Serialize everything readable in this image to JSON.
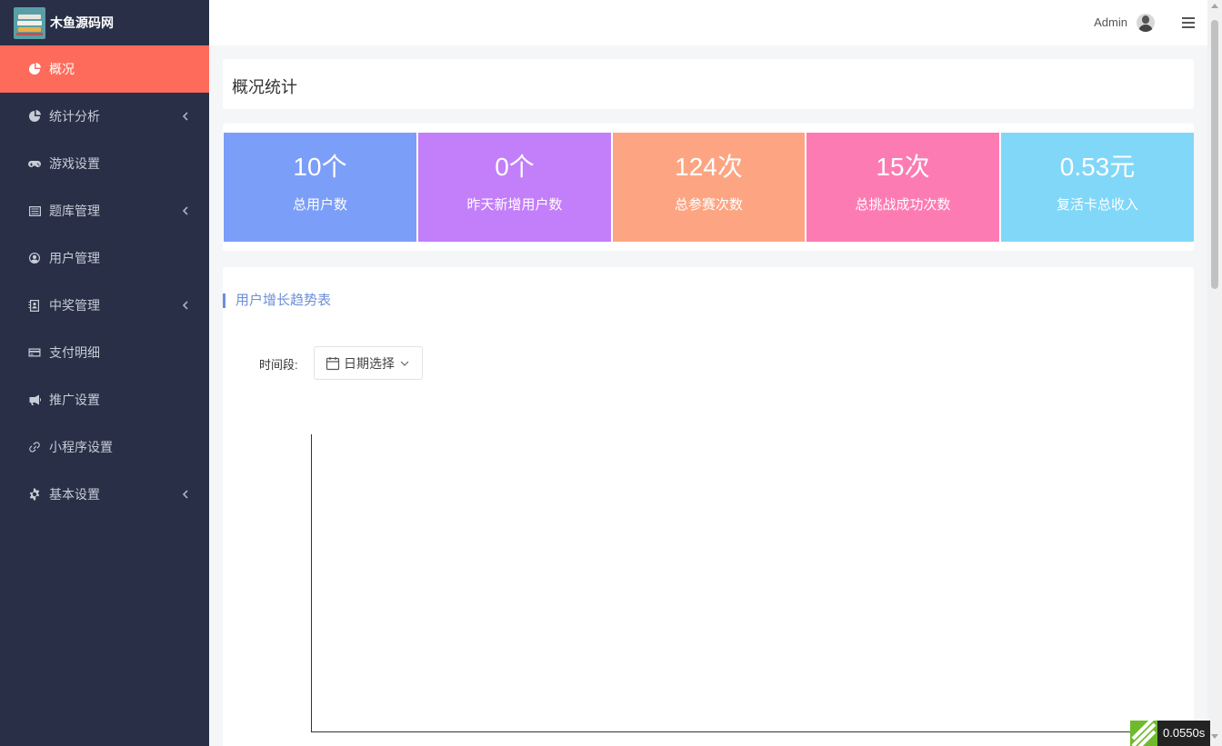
{
  "brand": {
    "name": "木鱼源码网"
  },
  "sidebar": {
    "items": [
      {
        "label": "概况",
        "icon": "pie-chart-icon",
        "active": true,
        "has_submenu": false
      },
      {
        "label": "统计分析",
        "icon": "pie-chart-icon",
        "active": false,
        "has_submenu": true
      },
      {
        "label": "游戏设置",
        "icon": "gamepad-icon",
        "active": false,
        "has_submenu": false
      },
      {
        "label": "题库管理",
        "icon": "list-icon",
        "active": false,
        "has_submenu": true
      },
      {
        "label": "用户管理",
        "icon": "user-circle-icon",
        "active": false,
        "has_submenu": false
      },
      {
        "label": "中奖管理",
        "icon": "contact-card-icon",
        "active": false,
        "has_submenu": true
      },
      {
        "label": "支付明细",
        "icon": "credit-card-icon",
        "active": false,
        "has_submenu": false
      },
      {
        "label": "推广设置",
        "icon": "bullhorn-icon",
        "active": false,
        "has_submenu": false
      },
      {
        "label": "小程序设置",
        "icon": "link-icon",
        "active": false,
        "has_submenu": false
      },
      {
        "label": "基本设置",
        "icon": "gear-icon",
        "active": false,
        "has_submenu": true
      }
    ]
  },
  "header": {
    "user": "Admin"
  },
  "page": {
    "title": "概况统计"
  },
  "stats": [
    {
      "value": "10个",
      "label": "总用户数",
      "color": "#7b9ef8"
    },
    {
      "value": "0个",
      "label": "昨天新增用户数",
      "color": "#c37ef9"
    },
    {
      "value": "124次",
      "label": "总参赛次数",
      "color": "#fda583"
    },
    {
      "value": "15次",
      "label": "总挑战成功次数",
      "color": "#fd7bb3"
    },
    {
      "value": "0.53元",
      "label": "复活卡总收入",
      "color": "#81d7f8"
    }
  ],
  "chart_section": {
    "title": "用户增长趋势表",
    "period_label": "时间段:",
    "date_picker_text": "日期选择"
  },
  "chart_data": {
    "type": "line",
    "title": "",
    "x": [],
    "series": []
  },
  "timer": {
    "text": "0.0550s"
  },
  "colors": {
    "sidebar_bg": "#282f47",
    "active": "#ff6b5b",
    "accent": "#6c8fd8"
  }
}
